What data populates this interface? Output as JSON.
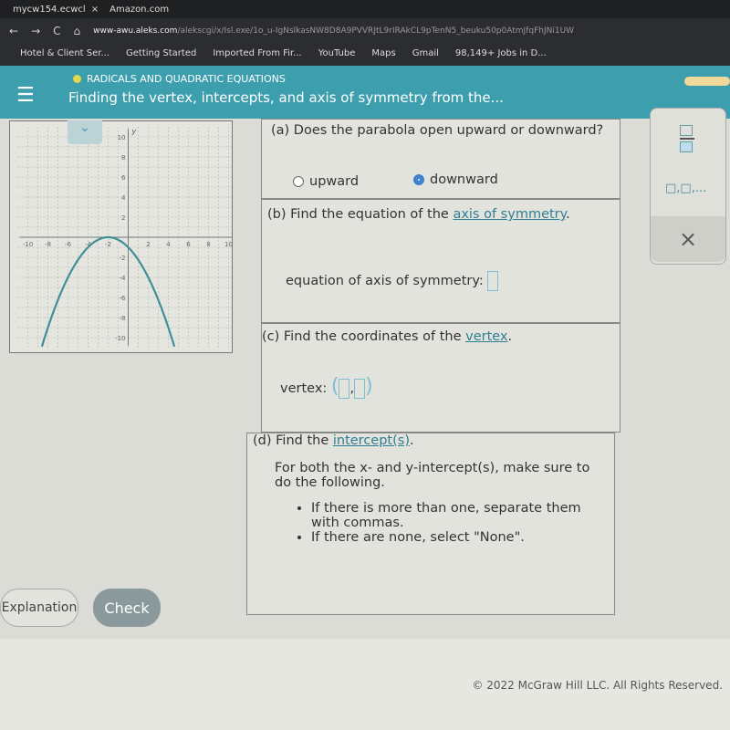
{
  "browser": {
    "tabs": [
      "mycw154.ecwcl",
      "Amazon.com"
    ],
    "url_host": "www-awu.aleks.com",
    "url_path": "/alekscgi/x/Isl.exe/1o_u-IgNslkasNW8D8A9PVVRJtL9rIRAkCL9pTenN5_beuku50p0AtmJfqFhJNi1UW",
    "bookmarks": [
      "Hotel & Client Ser...",
      "Getting Started",
      "Imported From Fir...",
      "YouTube",
      "Maps",
      "Gmail",
      "98,149+ Jobs in D..."
    ]
  },
  "header": {
    "category": "RADICALS AND QUADRATIC EQUATIONS",
    "title": "Finding the vertex, intercepts, and axis of symmetry from the..."
  },
  "graph": {
    "x_ticks": [
      "-10",
      "-8",
      "-6",
      "-4",
      "-2",
      "2",
      "4",
      "6",
      "8",
      "10"
    ],
    "y_ticks": [
      "10",
      "8",
      "6",
      "4",
      "2",
      "-2",
      "-4",
      "-6",
      "-8",
      "-10"
    ],
    "x_label": "x",
    "y_label": "y",
    "curve_color": "#3f8f96",
    "vertex": [
      -2,
      0
    ],
    "passes_through": [
      0,
      -1
    ],
    "xlim": [
      -10,
      10
    ],
    "ylim": [
      -10,
      10
    ]
  },
  "qa": {
    "prompt": "(a) Does the parabola open upward or downward?",
    "opt_up": "upward",
    "opt_down": "downward",
    "selected": "downward"
  },
  "qb": {
    "prefix": "(b) Find the equation of the ",
    "link": "axis of symmetry",
    "suffix": ".",
    "label": "equation of axis of symmetry:"
  },
  "qc": {
    "prefix": "(c) Find the coordinates of the ",
    "link": "vertex",
    "suffix": ".",
    "label": "vertex:"
  },
  "qd": {
    "prefix": "(d) Find the ",
    "link": "intercept(s)",
    "suffix": ".",
    "instr": "For both the x- and y-intercept(s), make sure to do the following.",
    "bullets": [
      "If there is more than one, separate them with commas.",
      "If there are none, select \"None\"."
    ]
  },
  "side": {
    "fraction": "fraction-icon",
    "list": "□,□,...",
    "close": "×"
  },
  "footer": {
    "explanation": "Explanation",
    "check": "Check",
    "copyright": "© 2022 McGraw Hill LLC. All Rights Reserved."
  }
}
